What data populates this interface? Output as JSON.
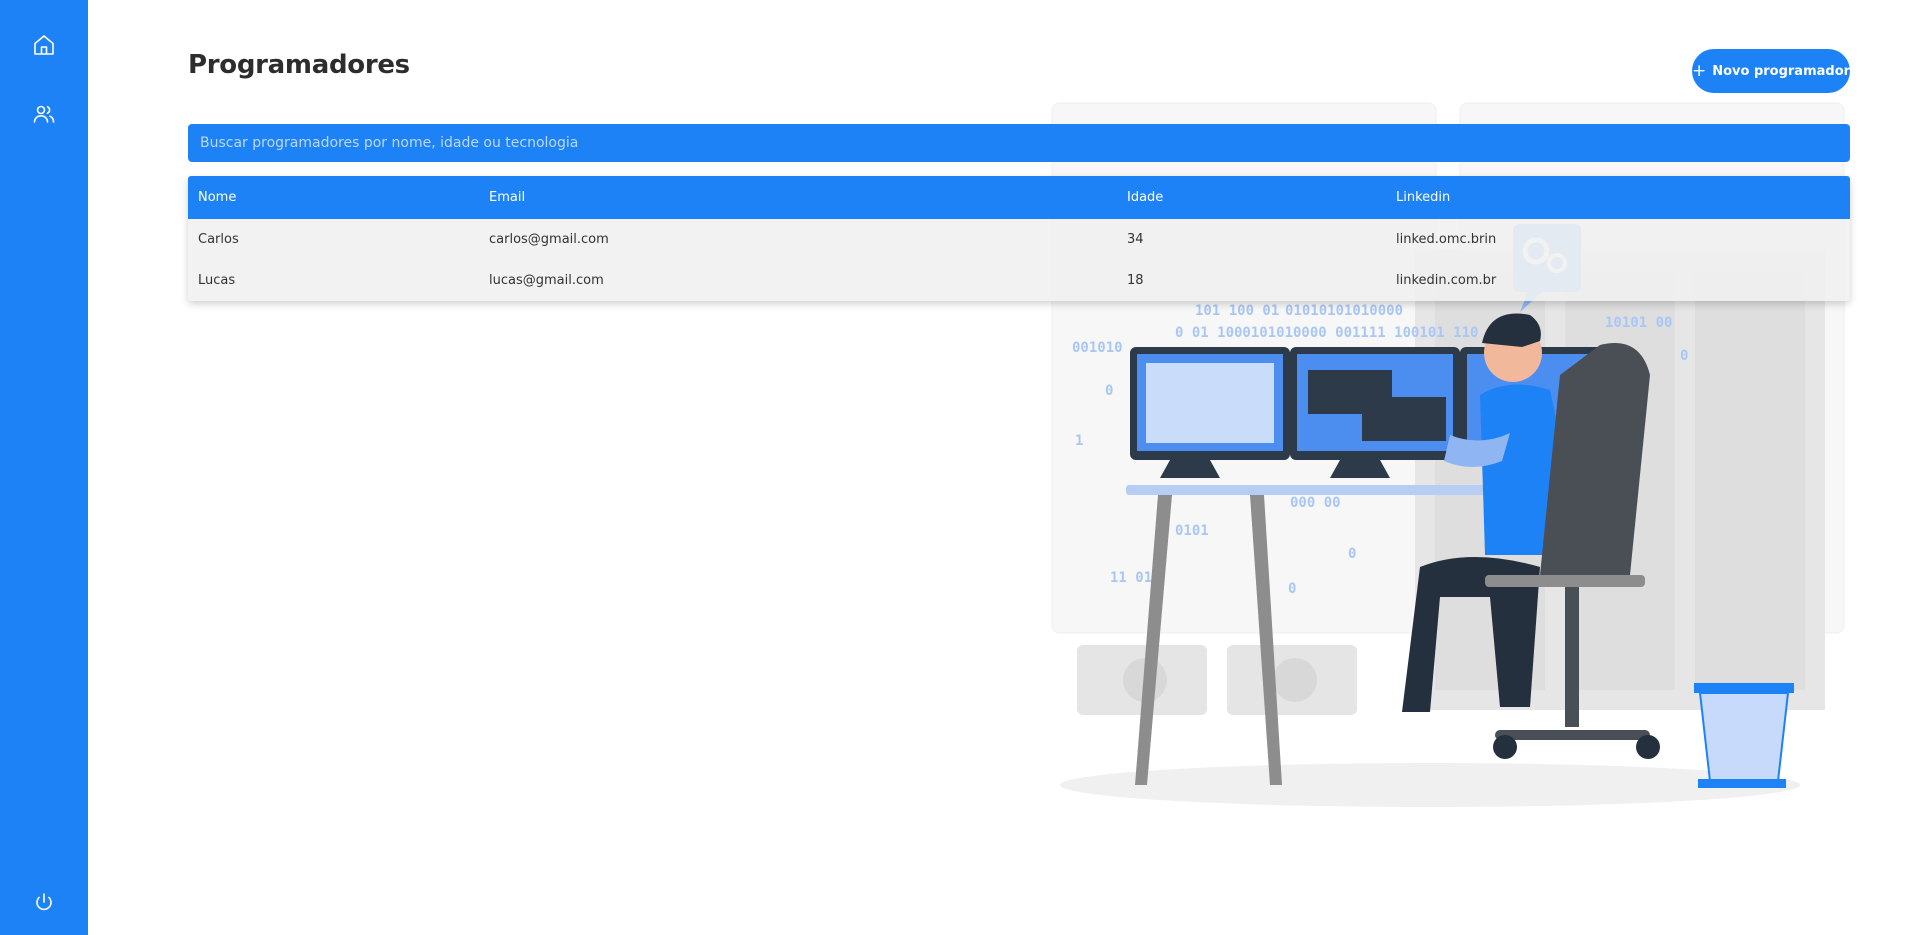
{
  "sidebar": {
    "items": [
      {
        "icon": "home-icon"
      },
      {
        "icon": "users-icon"
      }
    ],
    "bottom_icon": "power-icon"
  },
  "page": {
    "title": "Programadores",
    "new_button_label": "Novo programador",
    "new_button_icon": "plus-icon"
  },
  "search": {
    "placeholder": "Buscar programadores por nome, idade ou tecnologia",
    "value": ""
  },
  "table": {
    "headers": [
      "Nome",
      "Email",
      "Idade",
      "Linkedin"
    ],
    "rows": [
      [
        "Carlos",
        "carlos@gmail.com",
        "34",
        "linked.omc.brin"
      ],
      [
        "Lucas",
        "lucas@gmail.com",
        "18",
        "linkedin.com.br"
      ]
    ]
  },
  "illustration": {
    "name": "programmer-at-desk-illustration"
  },
  "colors": {
    "accent": "#1e82f7",
    "background": "#ffffff",
    "row_bg": "#f0f0f0"
  }
}
